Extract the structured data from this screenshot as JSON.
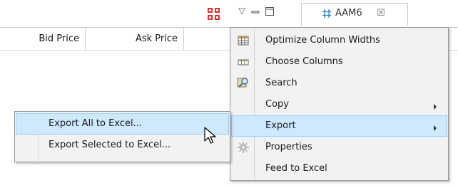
{
  "columns": {
    "bid": "Bid Price",
    "ask": "Ask Price"
  },
  "tab": {
    "label": "AAM6",
    "close_glyph": "☒",
    "icon": "grid-hash-icon",
    "accent": "#2c7ec9"
  },
  "toolbar": {
    "view_menu_glyph": "▽"
  },
  "context_menu": {
    "items": [
      {
        "label": "Optimize Column Widths",
        "icon": "column-widths-icon"
      },
      {
        "label": "Choose Columns",
        "icon": "columns-icon"
      },
      {
        "label": "Search",
        "icon": "search-icon"
      },
      {
        "label": "Copy",
        "has_submenu": true
      },
      {
        "label": "Export",
        "has_submenu": true,
        "highlighted": true
      },
      {
        "label": "Properties",
        "icon": "gear-icon"
      },
      {
        "label": "Feed to Excel"
      }
    ]
  },
  "export_submenu": {
    "items": [
      {
        "label": "Export All to Excel...",
        "highlighted": true
      },
      {
        "label": "Export Selected to Excel..."
      }
    ]
  },
  "colors": {
    "highlight_bg": "#cde8ff",
    "highlight_border": "#99d1ff",
    "menu_bg": "#f2f2f2"
  }
}
